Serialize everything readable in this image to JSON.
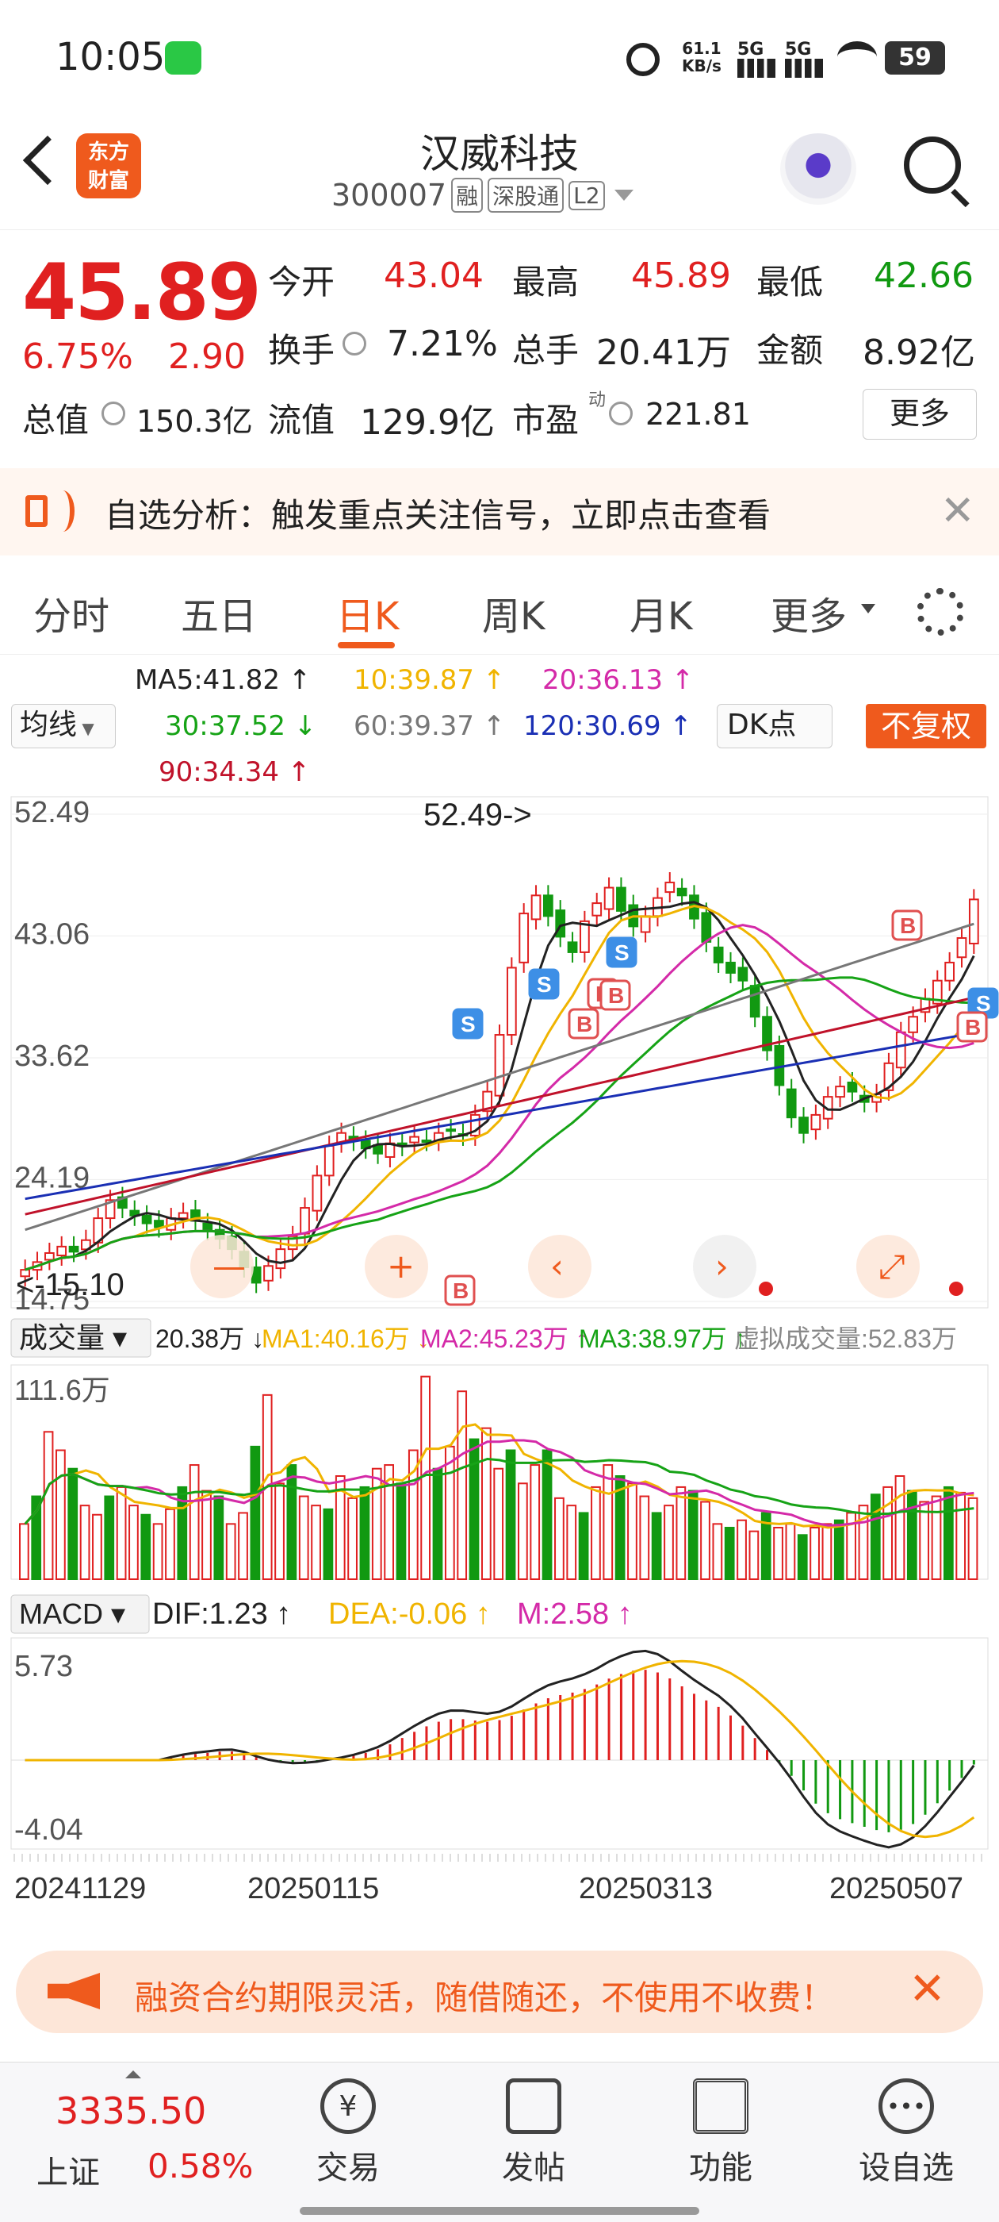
{
  "status_bar": {
    "time": "10:05",
    "net_speed": "61.1",
    "net_unit": "KB/s",
    "sig1": "5G",
    "sig2": "5G",
    "battery": "59"
  },
  "header": {
    "logo_line1": "东方",
    "logo_line2": "财富",
    "title": "汉威科技",
    "code": "300007",
    "tag_margin": "融",
    "tag_connect": "深股通",
    "tag_level": "L2"
  },
  "quote": {
    "price": "45.89",
    "change_pct": "6.75%",
    "change_amt": "2.90",
    "open_label": "今开",
    "open": "43.04",
    "high_label": "最高",
    "high": "45.89",
    "low_label": "最低",
    "low": "42.66",
    "turnover_label": "换手",
    "turnover": "7.21%",
    "volume_label": "总手",
    "volume": "20.41万",
    "amount_label": "金额",
    "amount": "8.92亿",
    "mktcap_label": "总值",
    "mktcap": "150.3亿",
    "float_label": "流值",
    "float": "129.9亿",
    "pe_label": "市盈",
    "pe_sup": "动",
    "pe": "221.81",
    "more": "更多"
  },
  "banner": {
    "text": "自选分析：触发重点关注信号，立即点击查看"
  },
  "tabs": [
    "分时",
    "五日",
    "日K",
    "周K",
    "月K",
    "更多"
  ],
  "ma_bar": {
    "selector": "均线",
    "dk": "DK点",
    "fq": "不复权",
    "ma5": "MA5:41.82 ↑",
    "ma10": "10:39.87 ↑",
    "ma20": "20:36.13 ↑",
    "ma30": "30:37.52 ↓",
    "ma60": "60:39.37 ↑",
    "ma120": "120:30.69 ↑",
    "ma90": "90:34.34 ↑"
  },
  "colors": {
    "red": "#e02020",
    "green": "#119911",
    "ma5": "#222222",
    "ma10": "#f0b400",
    "ma20": "#d42aa8",
    "ma30": "#16a316",
    "ma60": "#777777",
    "ma120": "#1a2fb4",
    "ma90": "#c0122a"
  },
  "chart_data": [
    {
      "type": "candlestick",
      "y_ticks": [
        "52.49",
        "43.06",
        "33.62",
        "24.19",
        "14.75"
      ],
      "high_marker": "52.49->",
      "low_marker": "<-15.10",
      "ylim": [
        14.75,
        52.49
      ],
      "close": [
        17.2,
        17.8,
        18.5,
        19.0,
        18.6,
        19.5,
        21.2,
        22.6,
        22.0,
        21.4,
        20.8,
        20.5,
        21.2,
        21.6,
        21.0,
        20.3,
        19.6,
        18.8,
        17.4,
        16.2,
        17.5,
        18.8,
        19.8,
        22.0,
        24.5,
        26.8,
        27.8,
        27.2,
        26.6,
        26.2,
        27.0,
        26.8,
        27.5,
        27.2,
        27.8,
        28.0,
        27.6,
        29.2,
        31.0,
        35.4,
        40.6,
        44.8,
        46.2,
        44.6,
        43.0,
        41.8,
        44.2,
        45.6,
        46.8,
        45.0,
        43.8,
        44.6,
        46.0,
        47.2,
        46.2,
        44.4,
        42.6,
        41.0,
        40.2,
        39.6,
        36.8,
        34.2,
        31.5,
        29.0,
        27.8,
        29.2,
        30.6,
        31.4,
        31.0,
        30.2,
        30.8,
        33.2,
        35.6,
        36.8,
        38.2,
        39.6,
        41.0,
        42.9,
        45.89
      ],
      "ma_lines": [
        "MA5",
        "MA10",
        "MA20",
        "MA30",
        "MA60",
        "MA120",
        "MA90"
      ],
      "signals": [
        "S",
        "B",
        "S",
        "B",
        "B",
        "B",
        "S",
        "B",
        "S",
        "B"
      ]
    },
    {
      "type": "bar",
      "title": "成交量",
      "current": "20.38万 ↓",
      "ma1": "MA1:40.16万 ↓",
      "ma2": "MA2:45.23万 ↑",
      "ma3": "MA3:38.97万 ↑",
      "virtual": "虚拟成交量:52.83万",
      "y_top": "111.6万",
      "values": [
        30,
        45,
        80,
        70,
        60,
        40,
        35,
        45,
        50,
        40,
        35,
        30,
        38,
        50,
        62,
        48,
        45,
        30,
        36,
        72,
        100,
        52,
        62,
        45,
        40,
        38,
        56,
        44,
        50,
        60,
        62,
        52,
        70,
        110,
        60,
        72,
        102,
        76,
        82,
        60,
        70,
        52,
        62,
        70,
        44,
        40,
        36,
        50,
        62,
        56,
        52,
        45,
        36,
        40,
        50,
        48,
        42,
        30,
        28,
        32,
        26,
        36,
        28,
        30,
        24,
        28,
        30,
        32,
        36,
        40,
        46,
        50,
        56,
        48,
        42,
        45,
        50,
        47,
        44
      ]
    },
    {
      "type": "bar",
      "title": "MACD",
      "dif": "DIF:1.23 ↑",
      "dea": "DEA:-0.06 ↑",
      "m": "M:2.58 ↑",
      "y_top": "5.73",
      "y_bottom": "-4.04",
      "x_labels": [
        "20241129",
        "20250115",
        "20250313",
        "20250507"
      ]
    }
  ],
  "promo": {
    "text": "融资合约期限灵活，随借随还，不使用不收费！"
  },
  "bottom_nav": {
    "index_value": "3335.50",
    "index_name": "上证",
    "index_change": "0.58%",
    "trade": "交易",
    "post": "发帖",
    "func": "功能",
    "watch": "设自选"
  }
}
